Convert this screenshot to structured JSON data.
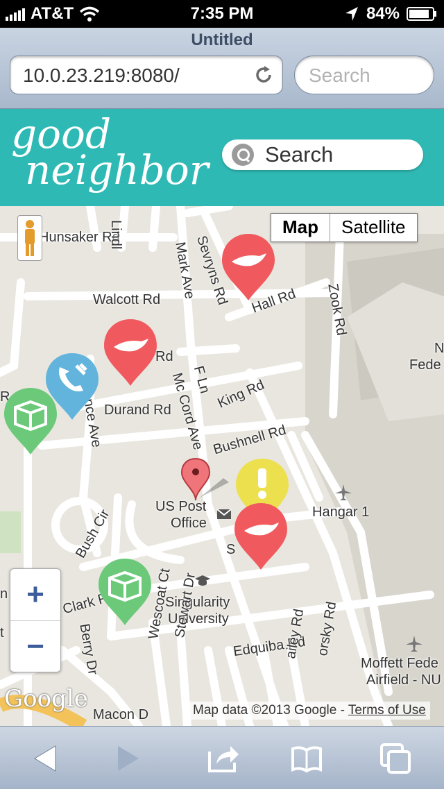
{
  "status": {
    "carrier": "AT&T",
    "time": "7:35 PM",
    "battery": "84%"
  },
  "browser": {
    "title": "Untitled",
    "url": "10.0.23.219:8080/",
    "search_placeholder": "Search"
  },
  "app": {
    "logo_line1": "good",
    "logo_line2": "neighbor",
    "search_label": "Search",
    "accent": "#2fb9b4"
  },
  "map": {
    "type_map": "Map",
    "type_satellite": "Satellite",
    "zoom_in": "+",
    "zoom_out": "−",
    "attribution_prefix": "Map data ©2013 Google - ",
    "terms": "Terms of Use",
    "google": "Google",
    "labels": {
      "hunsaker": "Hunsaker Rd",
      "lindl": "Lindl",
      "mark": "Mark Ave",
      "sevryns": "Sevryns Rd",
      "walcott": "Walcott Rd",
      "hall": "Hall Rd",
      "zook": "Zook Rd",
      "rd": "Rd",
      "fln": "F Ln",
      "mccord": "Mc Cord Ave",
      "king": "King Rd",
      "durand": "Durand Rd",
      "ence": "ence Ave",
      "bushnell": "Bushnell Rd",
      "uspost1": "US Post",
      "uspost2": "Office",
      "hangar": "Hangar 1",
      "bush": "Bush Cir",
      "s": "S",
      "clark": "Clark R",
      "sing1": "Singularity",
      "sing2": "University",
      "berry": "Berry Dr",
      "wescoat": "Wescoat Ct",
      "stewart": "Stewart Dr",
      "edquiba": "Edquiba Rd",
      "ailey": "ailey Rd",
      "orsky": "orsky Rd",
      "moffett1": "Moffett Fede",
      "moffett2": "Airfield - NU",
      "macon": "Macon D",
      "n": "N",
      "fede": "Fede",
      "r": "R",
      "t": "t",
      "n2": "n"
    },
    "marker_colors": {
      "help": "#f05a5f",
      "service": "#62b4dc",
      "item": "#6cc97a",
      "alert": "#ede04f"
    }
  }
}
